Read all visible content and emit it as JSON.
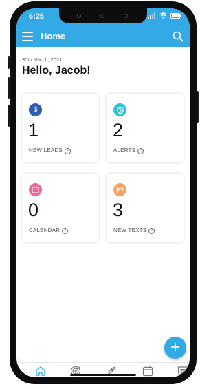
{
  "status_bar": {
    "time": "6:25"
  },
  "header": {
    "title": "Home"
  },
  "main": {
    "date": "30th March, 2021",
    "greeting": "Hello, Jacob!",
    "cards": [
      {
        "icon": "dollar-icon",
        "color": "#2f5fb3",
        "count": "1",
        "label": "NEW LEADS"
      },
      {
        "icon": "alarm-clock-icon",
        "color": "#2ec4d6",
        "count": "2",
        "label": "ALERTS"
      },
      {
        "icon": "calendar-icon",
        "color": "#e96a9a",
        "count": "0",
        "label": "CALENDAR"
      },
      {
        "icon": "chat-icon",
        "color": "#f4a261",
        "count": "3",
        "label": "NEW TEXTS"
      }
    ]
  },
  "bottom_nav": {
    "items": [
      {
        "icon": "home-icon"
      },
      {
        "icon": "target-icon"
      },
      {
        "icon": "rocket-icon"
      },
      {
        "icon": "calendar-icon"
      },
      {
        "icon": "message-icon"
      }
    ]
  },
  "colors": {
    "accent": "#33a9e5"
  }
}
